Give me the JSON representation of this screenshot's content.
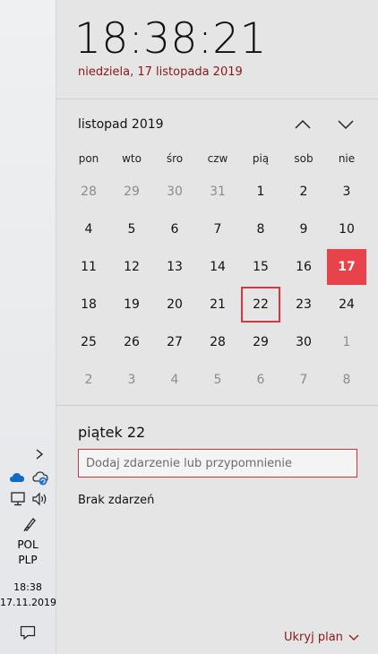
{
  "taskbar": {
    "tray_chevron": "chevron-right-icon",
    "tray_icons": [
      "onedrive-icon",
      "sync-cloud-icon",
      "network-icon",
      "volume-icon",
      "pen-icon"
    ],
    "language_line1": "POL",
    "language_line2": "PLP",
    "time": "18:38",
    "date": "17.11.2019",
    "notification_icon": "action-center-icon"
  },
  "clock": {
    "time": "18:38:21",
    "date_long": "niedziela, 17 listopada 2019"
  },
  "calendar": {
    "month_label": "listopad 2019",
    "weekdays": [
      "pon",
      "wto",
      "śro",
      "czw",
      "pią",
      "sob",
      "nie"
    ],
    "weeks": [
      [
        "28",
        "29",
        "30",
        "31",
        "1",
        "2",
        "3"
      ],
      [
        "4",
        "5",
        "6",
        "7",
        "8",
        "9",
        "10"
      ],
      [
        "11",
        "12",
        "13",
        "14",
        "15",
        "16",
        "17"
      ],
      [
        "18",
        "19",
        "20",
        "21",
        "22",
        "23",
        "24"
      ],
      [
        "25",
        "26",
        "27",
        "28",
        "29",
        "30",
        "1"
      ],
      [
        "2",
        "3",
        "4",
        "5",
        "6",
        "7",
        "8"
      ]
    ],
    "today": "17",
    "selected": "22"
  },
  "agenda": {
    "day_title": "piątek 22",
    "input_placeholder": "Dodaj zdarzenie lub przypomnienie",
    "input_value": "",
    "no_events": "Brak zdarzeń",
    "hide_label": "Ukryj plan"
  },
  "colors": {
    "accent": "#e8434a",
    "link": "#8a1717",
    "background": "#e5e5e5"
  }
}
